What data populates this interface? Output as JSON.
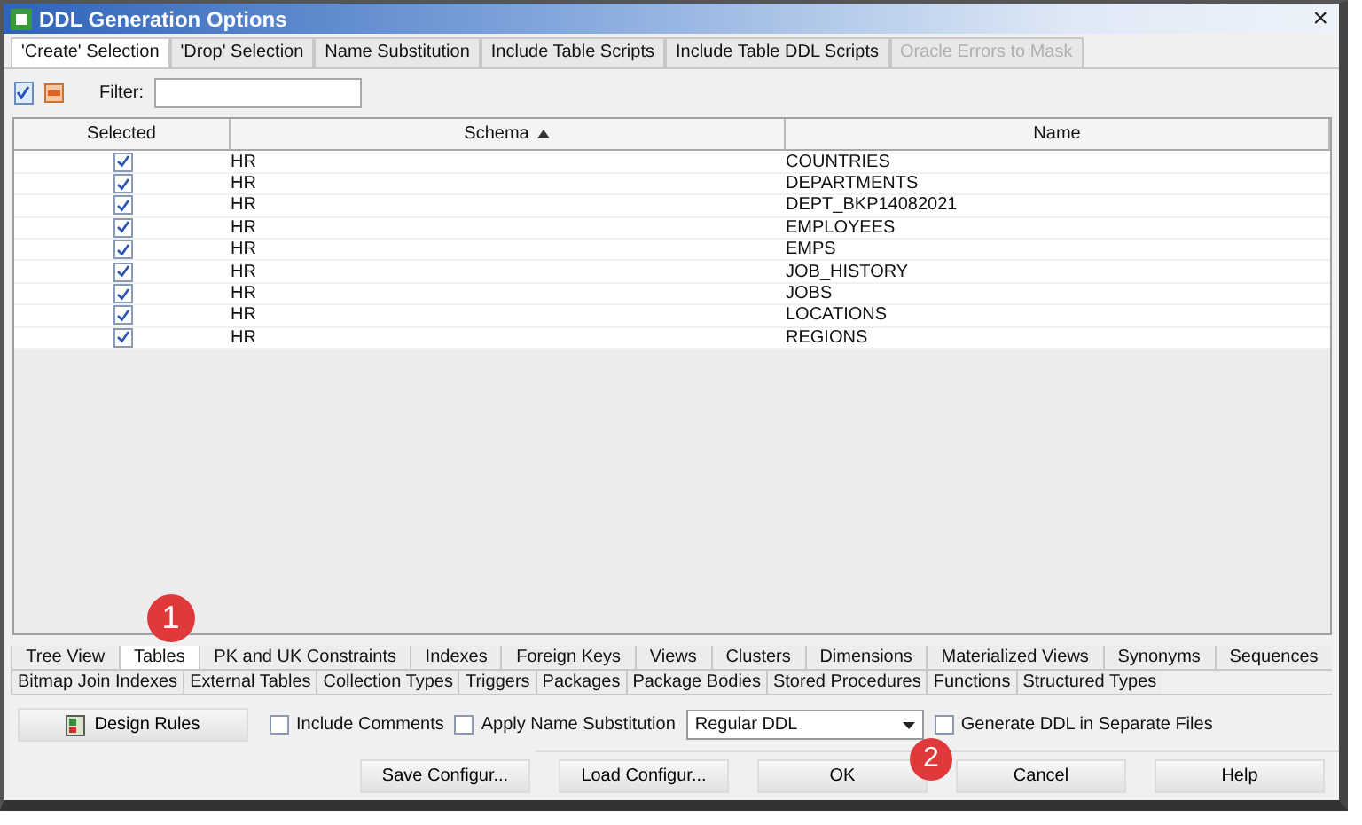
{
  "window": {
    "title": "DDL Generation Options",
    "close": "×"
  },
  "tabs": [
    {
      "label": "'Create' Selection",
      "selected": true,
      "disabled": false
    },
    {
      "label": "'Drop' Selection",
      "selected": false,
      "disabled": false
    },
    {
      "label": "Name Substitution",
      "selected": false,
      "disabled": false
    },
    {
      "label": "Include Table Scripts",
      "selected": false,
      "disabled": false
    },
    {
      "label": "Include Table DDL Scripts",
      "selected": false,
      "disabled": false
    },
    {
      "label": "Oracle Errors to Mask",
      "selected": false,
      "disabled": true
    }
  ],
  "filter": {
    "label": "Filter:"
  },
  "table": {
    "columns": [
      {
        "label": "Selected",
        "sorted": false
      },
      {
        "label": "Schema",
        "sorted": true
      },
      {
        "label": "Name",
        "sorted": false
      }
    ],
    "rows": [
      {
        "checked": true,
        "schema": "HR",
        "name": "COUNTRIES"
      },
      {
        "checked": true,
        "schema": "HR",
        "name": "DEPARTMENTS"
      },
      {
        "checked": true,
        "schema": "HR",
        "name": "DEPT_BKP14082021"
      },
      {
        "checked": true,
        "schema": "HR",
        "name": "EMPLOYEES"
      },
      {
        "checked": true,
        "schema": "HR",
        "name": "EMPS"
      },
      {
        "checked": true,
        "schema": "HR",
        "name": "JOB_HISTORY"
      },
      {
        "checked": true,
        "schema": "HR",
        "name": "JOBS"
      },
      {
        "checked": true,
        "schema": "HR",
        "name": "LOCATIONS"
      },
      {
        "checked": true,
        "schema": "HR",
        "name": "REGIONS"
      }
    ]
  },
  "object_tabs": [
    [
      {
        "label": "Tree View",
        "selected": false
      },
      {
        "label": "Tables",
        "selected": true,
        "callout": "1"
      },
      {
        "label": "PK and UK Constraints",
        "selected": false
      },
      {
        "label": "Indexes",
        "selected": false
      },
      {
        "label": "Foreign Keys",
        "selected": false
      },
      {
        "label": "Views",
        "selected": false
      },
      {
        "label": "Clusters",
        "selected": false
      },
      {
        "label": "Dimensions",
        "selected": false
      },
      {
        "label": "Materialized Views",
        "selected": false
      },
      {
        "label": "Synonyms",
        "selected": false
      },
      {
        "label": "Sequences",
        "selected": false
      }
    ],
    [
      {
        "label": "Bitmap Join Indexes",
        "selected": false
      },
      {
        "label": "External Tables",
        "selected": false
      },
      {
        "label": "Collection Types",
        "selected": false
      },
      {
        "label": "Triggers",
        "selected": false
      },
      {
        "label": "Packages",
        "selected": false
      },
      {
        "label": "Package Bodies",
        "selected": false
      },
      {
        "label": "Stored Procedures",
        "selected": false
      },
      {
        "label": "Functions",
        "selected": false
      },
      {
        "label": "Structured Types",
        "selected": false
      }
    ]
  ],
  "options": [
    {
      "kind": "button",
      "label": "Design Rules"
    },
    {
      "kind": "checkbox",
      "label": "Include Comments",
      "checked": false
    },
    {
      "kind": "checkbox",
      "label": "Apply Name Substitution",
      "checked": false
    },
    {
      "kind": "dropdown",
      "value": "Regular DDL"
    },
    {
      "kind": "checkbox",
      "label": "Generate DDL in Separate Files",
      "checked": false
    }
  ],
  "buttons": [
    {
      "label": "Save Configur..."
    },
    {
      "label": "Load Configur..."
    },
    {
      "label": "OK",
      "callout": "2"
    },
    {
      "label": "Cancel"
    },
    {
      "label": "Help"
    }
  ]
}
